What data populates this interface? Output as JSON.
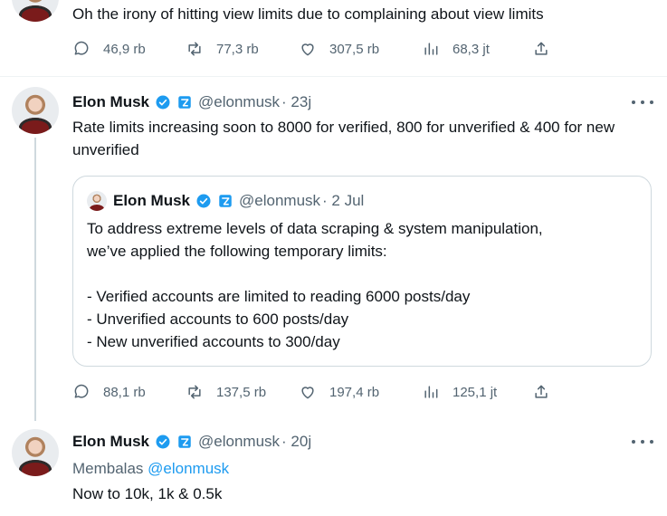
{
  "tweet0": {
    "text": "Oh the irony of hitting view limits due to complaining about view limits",
    "stats": {
      "replies": "46,9 rb",
      "reposts": "77,3 rb",
      "likes": "307,5 rb",
      "views": "68,3 jt"
    }
  },
  "tweet1": {
    "name": "Elon Musk",
    "handle": "@elonmusk",
    "time": "· 23j",
    "text": "Rate limits increasing soon to 8000 for verified, 800 for unverified & 400 for new unverified",
    "quote": {
      "name": "Elon Musk",
      "handle": "@elonmusk",
      "time": "· 2 Jul",
      "lines": [
        "To address extreme levels of data scraping & system manipulation,",
        "we’ve applied the following temporary limits:",
        "",
        "- Verified accounts are limited to reading 6000 posts/day",
        "- Unverified accounts to 600 posts/day",
        "- New unverified accounts to 300/day"
      ]
    },
    "stats": {
      "replies": "88,1 rb",
      "reposts": "137,5 rb",
      "likes": "197,4 rb",
      "views": "125,1 jt"
    }
  },
  "tweet2": {
    "name": "Elon Musk",
    "handle": "@elonmusk",
    "time": "· 20j",
    "reply_prefix": "Membalas",
    "reply_to": "@elonmusk",
    "text": "Now to 10k, 1k & 0.5k"
  },
  "colors": {
    "accent": "#1d9bf0",
    "muted": "#536471",
    "text": "#0f1419",
    "border": "#cfd9de"
  },
  "icons": [
    "reply-icon",
    "repost-icon",
    "like-icon",
    "views-icon",
    "share-icon",
    "verified-icon",
    "gold-badge-icon",
    "more-icon"
  ]
}
